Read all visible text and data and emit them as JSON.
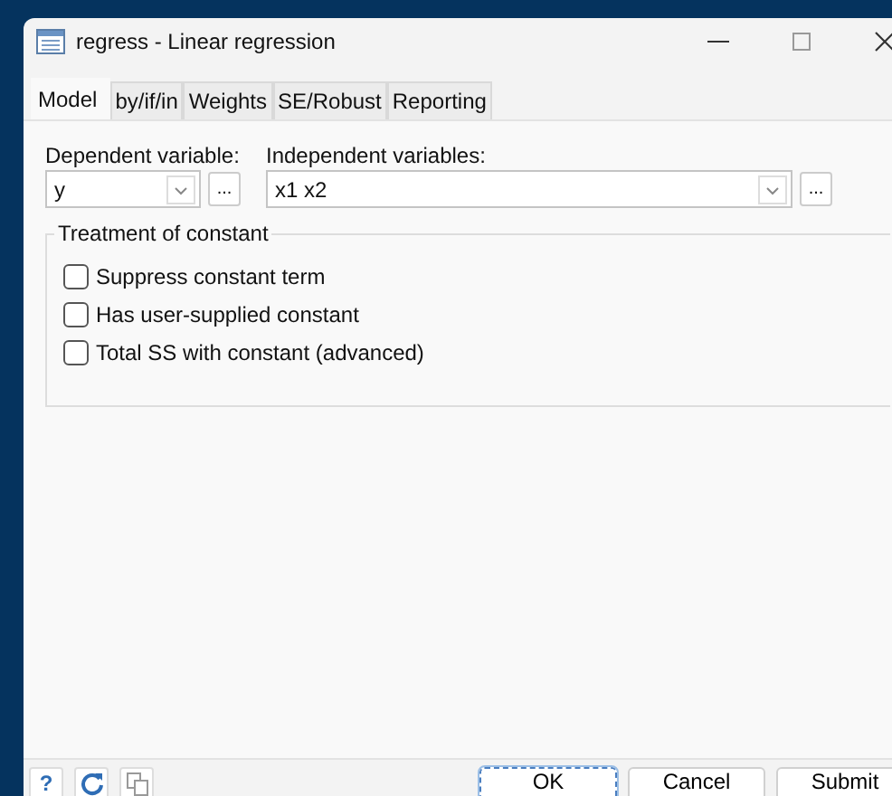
{
  "window": {
    "title": "regress - Linear regression"
  },
  "tabs": [
    {
      "label": "Model",
      "selected": true
    },
    {
      "label": "by/if/in",
      "selected": false
    },
    {
      "label": "Weights",
      "selected": false
    },
    {
      "label": "SE/Robust",
      "selected": false
    },
    {
      "label": "Reporting",
      "selected": false
    }
  ],
  "dependent_variable": {
    "label": "Dependent variable:",
    "value": "y",
    "browse_button": "..."
  },
  "independent_variables": {
    "label": "Independent variables:",
    "value": "x1 x2",
    "browse_button": "..."
  },
  "treatment_of_constant": {
    "title": "Treatment of constant",
    "options": [
      {
        "label": "Suppress constant term",
        "checked": false
      },
      {
        "label": "Has user-supplied constant",
        "checked": false
      },
      {
        "label": "Total SS with constant (advanced)",
        "checked": false
      }
    ]
  },
  "footer": {
    "help_button": "?",
    "buttons": [
      {
        "label": "OK",
        "selected": true
      },
      {
        "label": "Cancel",
        "selected": false
      },
      {
        "label": "Submit",
        "selected": false
      }
    ]
  }
}
